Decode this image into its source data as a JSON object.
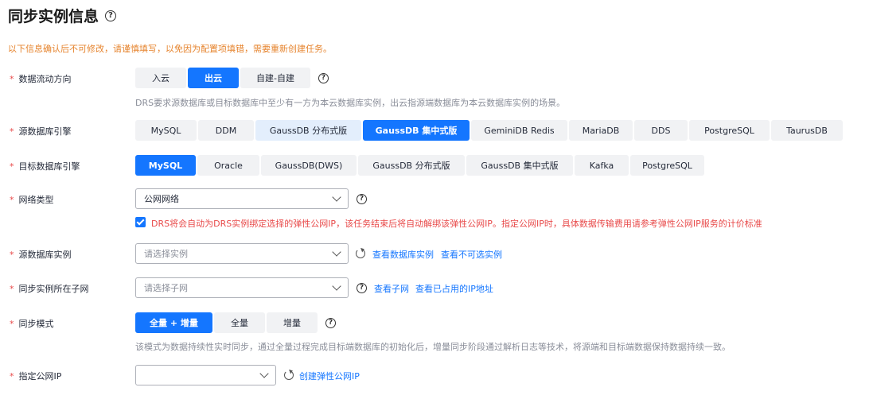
{
  "page": {
    "title": "同步实例信息",
    "notice": "以下信息确认后不可修改，请谨慎填写，以免因为配置项填错，需要重新创建任务。"
  },
  "flow": {
    "label": "数据流动方向",
    "options": [
      "入云",
      "出云",
      "自建-自建"
    ],
    "selected": "出云",
    "hint": "DRS要求源数据库或目标数据库中至少有一方为本云数据库实例，出云指源端数据库为本云数据库实例的场景。"
  },
  "source_engine": {
    "label": "源数据库引擎",
    "options": [
      "MySQL",
      "DDM",
      "GaussDB 分布式版",
      "GaussDB 集中式版",
      "GeminiDB Redis",
      "MariaDB",
      "DDS",
      "PostgreSQL",
      "TaurusDB"
    ],
    "selected": "GaussDB 集中式版",
    "hovered": "GaussDB 分布式版"
  },
  "target_engine": {
    "label": "目标数据库引擎",
    "options": [
      "MySQL",
      "Oracle",
      "GaussDB(DWS)",
      "GaussDB 分布式版",
      "GaussDB 集中式版",
      "Kafka",
      "PostgreSQL"
    ],
    "selected": "MySQL"
  },
  "network": {
    "label": "网络类型",
    "value": "公网网络",
    "checkbox_checked": true,
    "checkbox_text": "DRS将会自动为DRS实例绑定选择的弹性公网IP，该任务结束后将自动解绑该弹性公网IP。指定公网IP时，具体数据传输费用请参考弹性公网IP服务的计价标准"
  },
  "source_instance": {
    "label": "源数据库实例",
    "placeholder": "请选择实例",
    "link1": "查看数据库实例",
    "link2": "查看不可选实例"
  },
  "subnet": {
    "label": "同步实例所在子网",
    "placeholder": "请选择子网",
    "link1": "查看子网",
    "link2": "查看已占用的IP地址"
  },
  "sync_mode": {
    "label": "同步模式",
    "options": [
      "全量 + 增量",
      "全量",
      "增量"
    ],
    "selected": "全量 + 增量",
    "hint": "该模式为数据持续性实时同步，通过全量过程完成目标端数据库的初始化后，增量同步阶段通过解析日志等技术，将源端和目标端数据保持数据持续一致。"
  },
  "public_ip": {
    "label": "指定公网IP",
    "value": "",
    "link": "创建弹性公网IP"
  },
  "icons": [
    "help-icon",
    "chevron-down-icon",
    "refresh-icon",
    "checkbox-icon"
  ],
  "colors": {
    "primary": "#1476ff",
    "required": "#e84a4a",
    "notice": "#e6842e",
    "hint": "#8a8e99"
  }
}
